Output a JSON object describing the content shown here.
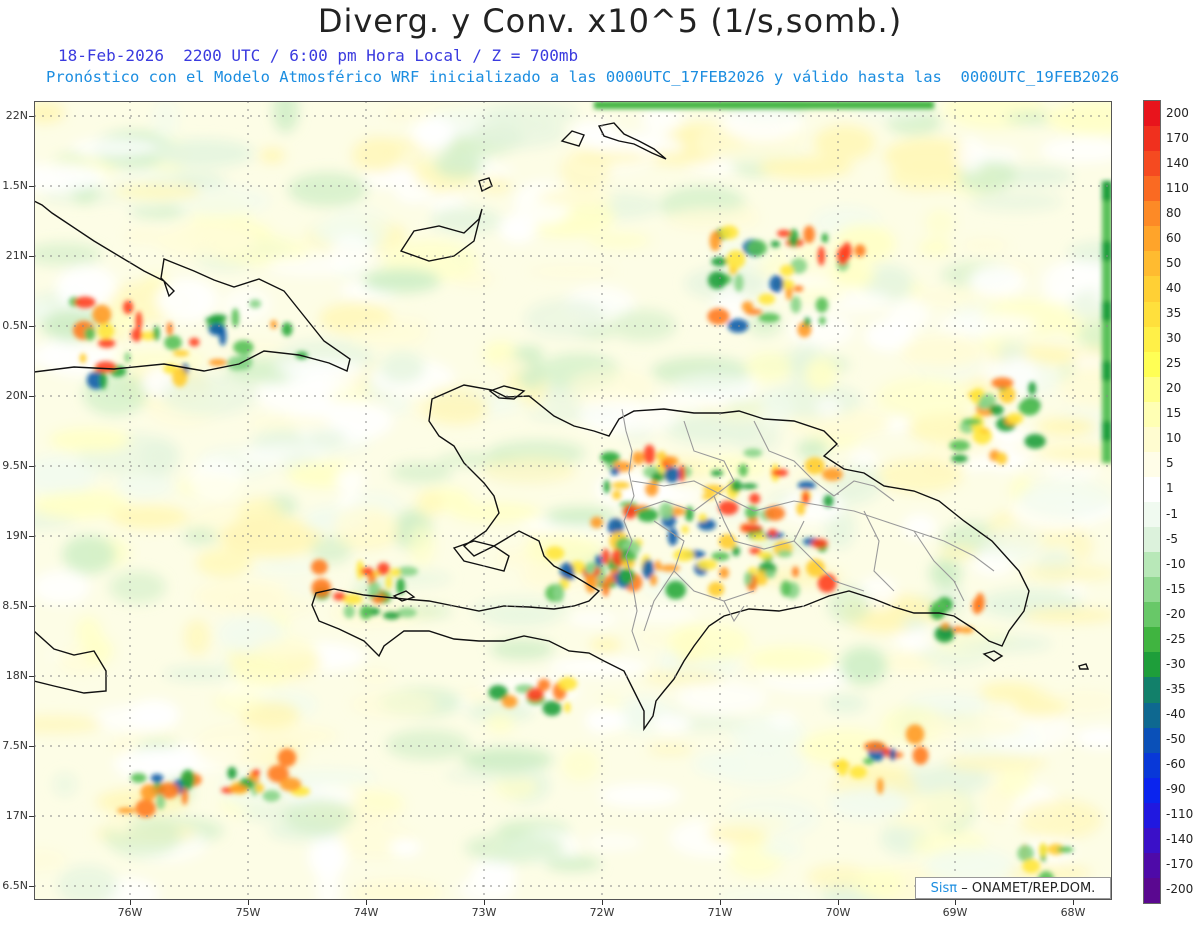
{
  "header": {
    "title": "Diverg. y Conv. x10^5 (1/s,somb.)",
    "subtitle_date": "18-Feb-2026  2200 UTC / 6:00 pm Hora Local / Z = 700mb",
    "subtitle_model": "Pronóstico con el Modelo Atmosférico WRF inicializado a las 0000UTC_17FEB2026 y válido hasta las  0000UTC_19FEB2026"
  },
  "map": {
    "lat_labels": [
      "22N",
      "1.5N",
      "21N",
      "0.5N",
      "20N",
      "9.5N",
      "19N",
      "8.5N",
      "18N",
      "7.5N",
      "17N",
      "6.5N"
    ],
    "lon_labels": [
      "76W",
      "75W",
      "74W",
      "73W",
      "72W",
      "71W",
      "70W",
      "69W",
      "68W"
    ],
    "lon_range": [
      -76.6,
      -67.6
    ],
    "lat_range": [
      16.45,
      22.1
    ]
  },
  "colorbar": {
    "labels": [
      "200",
      "170",
      "140",
      "110",
      "80",
      "60",
      "50",
      "40",
      "35",
      "30",
      "25",
      "20",
      "15",
      "10",
      "5",
      "1",
      "-1",
      "-5",
      "-10",
      "-15",
      "-20",
      "-25",
      "-30",
      "-35",
      "-40",
      "-50",
      "-60",
      "-90",
      "-110",
      "-140",
      "-170",
      "-200"
    ],
    "colors": [
      "#e8141c",
      "#f0301e",
      "#f54a20",
      "#fa6a22",
      "#fd8a26",
      "#ffa42a",
      "#ffbb30",
      "#ffd035",
      "#ffe03c",
      "#fff048",
      "#ffff55",
      "#ffff8a",
      "#ffffb4",
      "#fffcd0",
      "#fffde8",
      "#ffffff",
      "#f0faf0",
      "#dcf2dc",
      "#b8e8b8",
      "#90d890",
      "#68c868",
      "#40b440",
      "#1e9e3a",
      "#12806a",
      "#0e6890",
      "#0a50b8",
      "#0838d8",
      "#0a24ee",
      "#2018e0",
      "#3a10c8",
      "#4e0aa8",
      "#5a0890"
    ]
  },
  "credit": {
    "org": "Sisπ",
    "text": "– ONAMET/REP.DOM."
  }
}
